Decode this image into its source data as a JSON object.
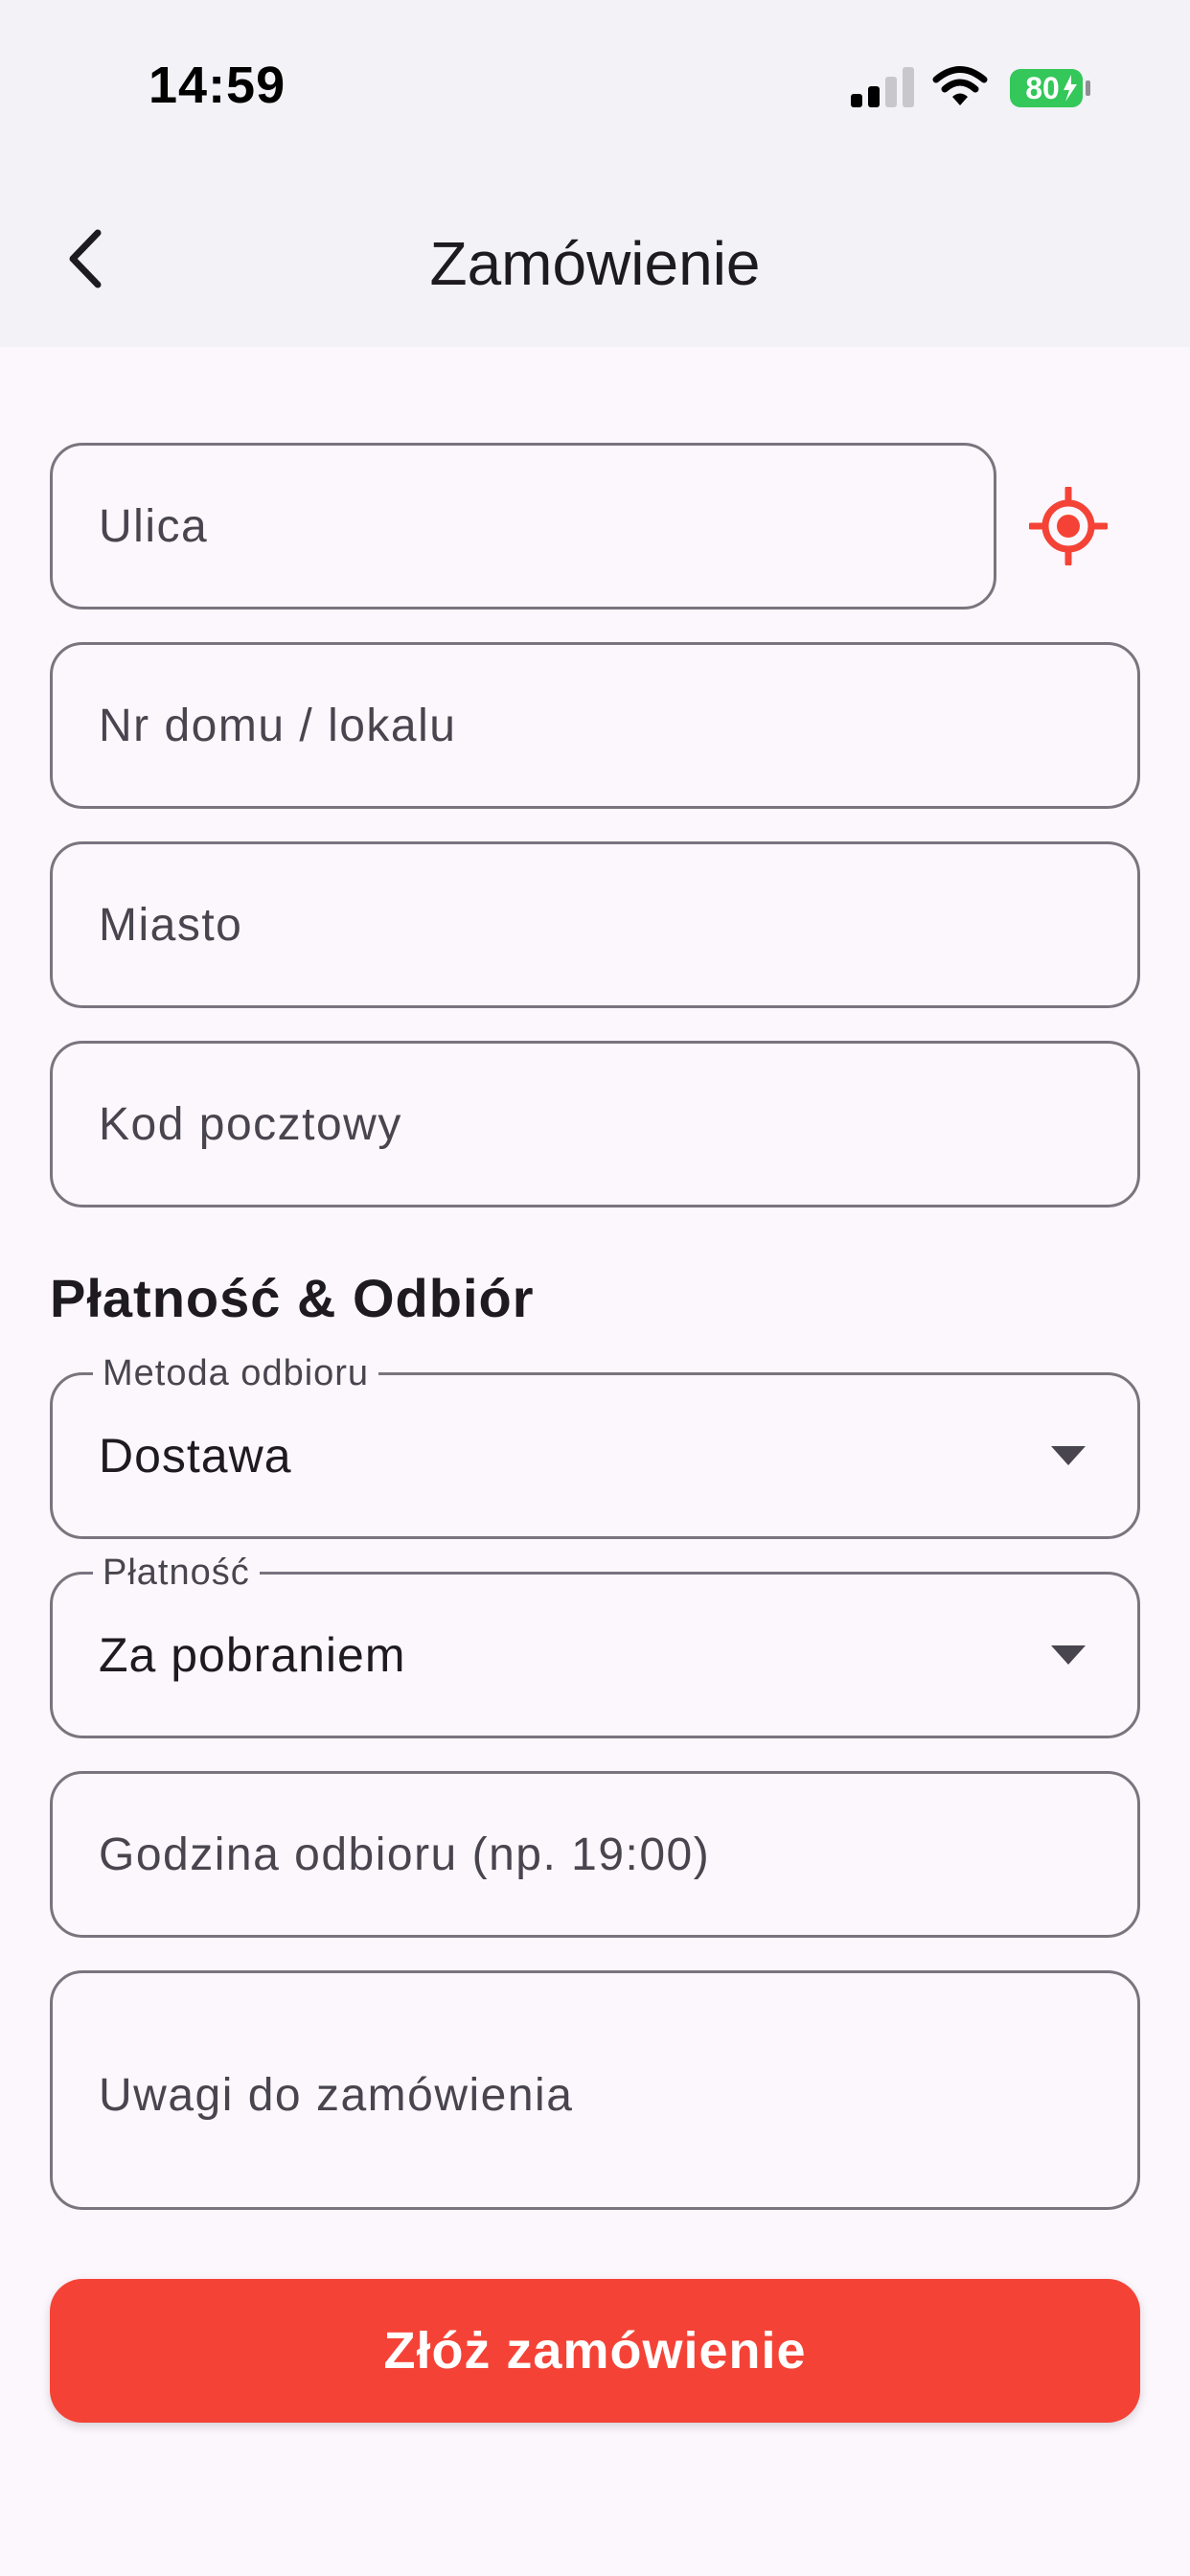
{
  "status_bar": {
    "time": "14:59",
    "battery": "80"
  },
  "app_bar": {
    "title": "Zamówienie"
  },
  "form": {
    "street": {
      "placeholder": "Ulica",
      "value": ""
    },
    "house_number": {
      "placeholder": "Nr domu / lokalu",
      "value": ""
    },
    "city": {
      "placeholder": "Miasto",
      "value": ""
    },
    "postal_code": {
      "placeholder": "Kod pocztowy",
      "value": ""
    },
    "section_title": "Płatność & Odbiór",
    "pickup_method": {
      "label": "Metoda odbioru",
      "value": "Dostawa"
    },
    "payment": {
      "label": "Płatność",
      "value": "Za pobraniem"
    },
    "pickup_time": {
      "placeholder": "Godzina odbioru (np. 19:00)",
      "value": ""
    },
    "notes": {
      "placeholder": "Uwagi do zamówienia",
      "value": ""
    },
    "submit_label": "Złóż zamówienie"
  },
  "icons": {
    "back": "chevron-left-icon",
    "locate": "gps-target-icon",
    "dropdown": "caret-down-icon"
  },
  "colors": {
    "accent": "#f44336",
    "battery": "#34c759",
    "border": "#79747e",
    "background": "#fcf7fd",
    "header": "#f2f2f7"
  }
}
